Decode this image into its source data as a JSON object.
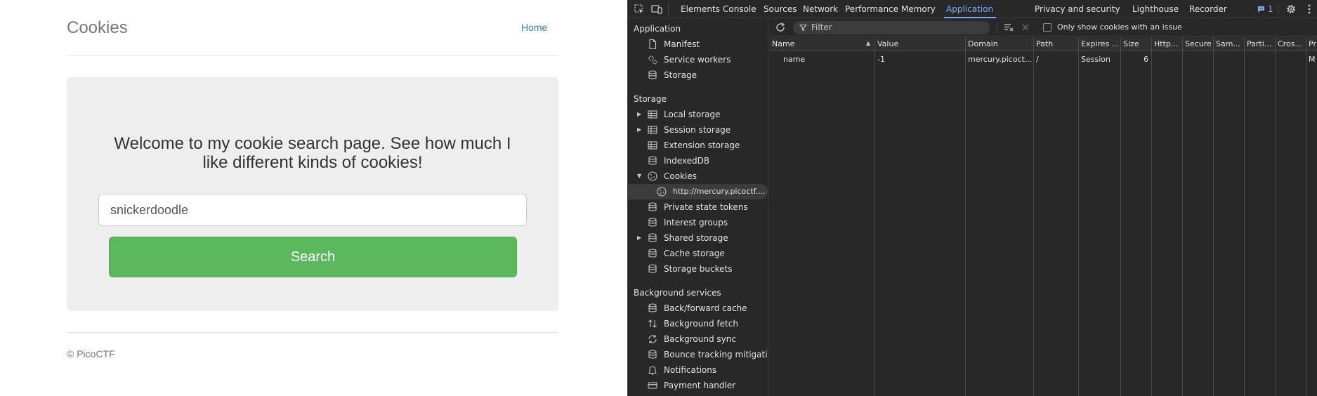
{
  "page": {
    "title": "Cookies",
    "nav_home": "Home",
    "welcome": "Welcome to my cookie search page. See how much I like different kinds of cookies!",
    "search_value": "snickerdoodle",
    "search_button": "Search",
    "footer": "© PicoCTF"
  },
  "devtools": {
    "tabs": [
      "Elements",
      "Console",
      "Sources",
      "Network",
      "Performance",
      "Memory",
      "Application",
      "Privacy and security",
      "Lighthouse",
      "Recorder"
    ],
    "active_tab": "Application",
    "issues_count": "1",
    "sidebar": {
      "application_header": "Application",
      "application_items": [
        "Manifest",
        "Service workers",
        "Storage"
      ],
      "storage_header": "Storage",
      "storage_items": [
        "Local storage",
        "Session storage",
        "Extension storage",
        "IndexedDB",
        "Cookies",
        "http://mercury.picoctf....",
        "Private state tokens",
        "Interest groups",
        "Shared storage",
        "Cache storage",
        "Storage buckets"
      ],
      "background_header": "Background services",
      "background_items": [
        "Back/forward cache",
        "Background fetch",
        "Background sync",
        "Bounce tracking mitigati...",
        "Notifications",
        "Payment handler"
      ]
    },
    "toolbar": {
      "filter_placeholder": "Filter",
      "only_issues_label": "Only show cookies with an issue"
    },
    "table": {
      "headers": [
        "Name",
        "Value",
        "Domain",
        "Path",
        "Expires ...",
        "Size",
        "Http...",
        "Secure",
        "Sam...",
        "Parti...",
        "Cros...",
        "Pr"
      ],
      "rows": [
        [
          "name",
          "-1",
          "mercury.picoct...",
          "/",
          "Session",
          "6",
          "",
          "",
          "",
          "",
          "",
          "M"
        ]
      ]
    }
  }
}
